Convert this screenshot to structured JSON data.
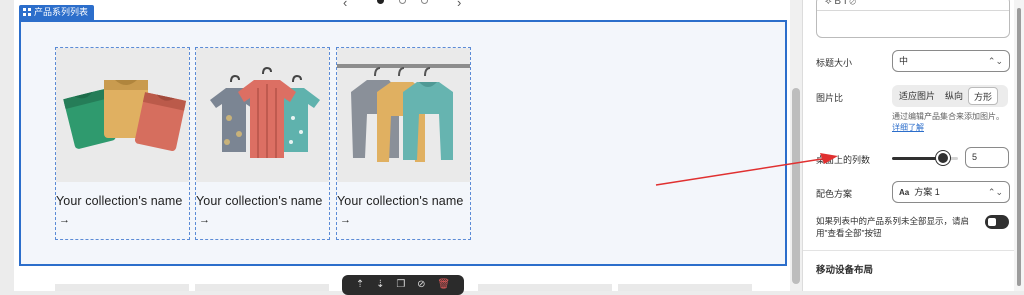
{
  "section": {
    "tag": "产品系列列表",
    "cards": [
      {
        "name": "Your collection's name",
        "arrow": "→"
      },
      {
        "name": "Your collection's name",
        "arrow": "→"
      },
      {
        "name": "Your collection's name",
        "arrow": "→"
      }
    ]
  },
  "carousel": {
    "prev": "‹",
    "next": "›"
  },
  "panel": {
    "editor_tools": "⟡  B  I  ⊘",
    "title_size": {
      "label": "标题大小",
      "value": "中"
    },
    "image_ratio": {
      "label": "图片比",
      "options": [
        "适应图片",
        "纵向",
        "方形"
      ],
      "selected": "方形",
      "help": "通过编辑产品集合来添加图片。",
      "help_link": "详细了解"
    },
    "columns": {
      "label": "桌面上的列数",
      "value": "5"
    },
    "color_scheme": {
      "label": "配色方案",
      "value": "方案 1",
      "icon_text": "Aa"
    },
    "view_all": {
      "label": "如果列表中的产品系列未全部显示，请启用\"查看全部\"按钮"
    },
    "mobile_heading": "移动设备布局"
  },
  "colors": {
    "accent": "#2c6ecb",
    "annotation_arrow": "#e03030"
  }
}
